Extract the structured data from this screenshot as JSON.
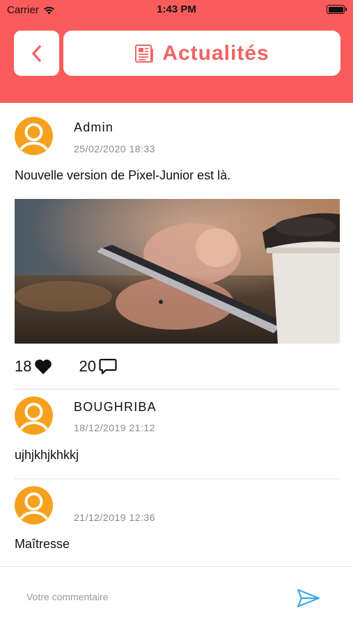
{
  "status_bar": {
    "carrier": "Carrier",
    "time": "1:43 PM"
  },
  "header": {
    "title": "Actualités",
    "icon": "newspaper-icon",
    "back_icon": "chevron-left-icon"
  },
  "colors": {
    "header_bg": "#fa5c5c",
    "accent": "#f06464",
    "avatar_orange": "#f5a11d",
    "send_blue": "#3aa7e8"
  },
  "post": {
    "author": "Admin",
    "date": "25/02/2020 18:33",
    "text": "Nouvelle version de Pixel-Junior est là.",
    "image": "photo of hand holding a smartphone next to a coffee cup",
    "likes": "18",
    "comments": "20"
  },
  "comments": [
    {
      "author": "BOUGHRIBA",
      "date": "18/12/2019 21:12",
      "text": "ujhjkhjkhkkj"
    },
    {
      "author": "",
      "date": "21/12/2019 12:36",
      "text": "Maîtresse"
    }
  ],
  "composer": {
    "placeholder": "Votre commentaire",
    "send_icon": "send-icon"
  }
}
